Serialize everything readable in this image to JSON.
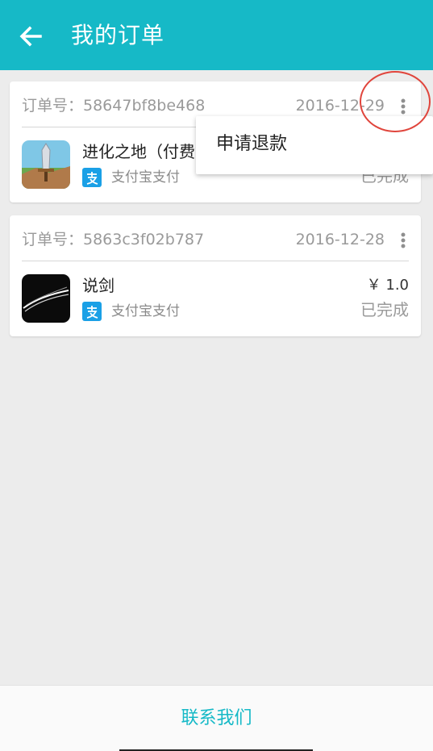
{
  "header": {
    "title": "我的订单",
    "back_icon": "arrow-left-icon"
  },
  "orders": [
    {
      "order_no": "订单号：58647bf8be468",
      "date": "2016-12-29",
      "app_name": "进化之地（付费",
      "payment": "支付宝支付",
      "price": "",
      "status": "已完成"
    },
    {
      "order_no": "订单号：5863c3f02b787",
      "date": "2016-12-28",
      "app_name": "说剑",
      "payment": "支付宝支付",
      "price": "￥ 1.0",
      "status": "已完成"
    }
  ],
  "popup_menu": {
    "items": [
      "申请退款"
    ]
  },
  "footer": {
    "contact_label": "联系我们"
  },
  "colors": {
    "primary": "#16b9c7",
    "alipay": "#1aa0e6",
    "annotation": "#e0453c"
  }
}
